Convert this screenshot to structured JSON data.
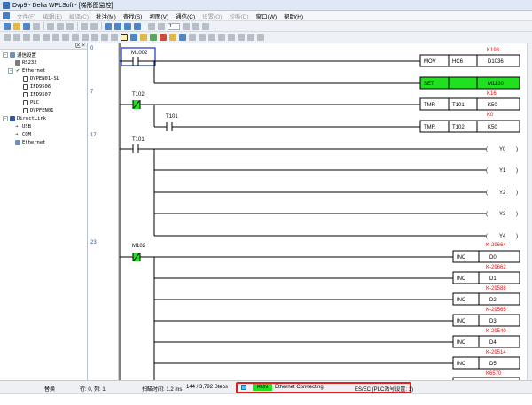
{
  "window": {
    "title": "Dvp9 - Delta WPLSoft - [梯形图监控]"
  },
  "menu": {
    "items": [
      {
        "label": "文件(F)",
        "disabled": true
      },
      {
        "label": "编辑(E)",
        "disabled": true
      },
      {
        "label": "编译(C)",
        "disabled": true
      },
      {
        "label": "批注(M)",
        "disabled": false
      },
      {
        "label": "查找(S)",
        "disabled": false
      },
      {
        "label": "视图(V)",
        "disabled": false
      },
      {
        "label": "通信(C)",
        "disabled": false
      },
      {
        "label": "设置(O)",
        "disabled": true
      },
      {
        "label": "诊断(D)",
        "disabled": true
      },
      {
        "label": "窗口(W)",
        "disabled": false
      },
      {
        "label": "帮助(H)",
        "disabled": false
      }
    ]
  },
  "toolbar": {
    "zoom_value": "1"
  },
  "tree": {
    "close_label": "区 ×",
    "items": [
      {
        "label": "通信设置",
        "level": 0,
        "icon": "network-icon",
        "expander": "-"
      },
      {
        "label": "RS232",
        "level": 1,
        "icon": "port-icon",
        "expander": ""
      },
      {
        "label": "Ethernet",
        "level": 1,
        "icon": "check-icon",
        "expander": "-"
      },
      {
        "label": "DVPEN01-SL",
        "level": 2,
        "icon": "document-icon",
        "expander": ""
      },
      {
        "label": "IFD9506",
        "level": 2,
        "icon": "document-icon",
        "expander": ""
      },
      {
        "label": "IFD9507",
        "level": 2,
        "icon": "document-icon",
        "expander": ""
      },
      {
        "label": "PLC",
        "level": 2,
        "icon": "document-icon",
        "expander": ""
      },
      {
        "label": "DVPFEN01",
        "level": 2,
        "icon": "document-icon",
        "expander": ""
      },
      {
        "label": "DirectLink",
        "level": 0,
        "icon": "directlink-icon",
        "expander": "-"
      },
      {
        "label": "USB",
        "level": 1,
        "icon": "arrow-icon",
        "expander": ""
      },
      {
        "label": "COM",
        "level": 1,
        "icon": "arrow-icon",
        "expander": ""
      },
      {
        "label": "Ethernet",
        "level": 1,
        "icon": "network-icon",
        "expander": ""
      }
    ]
  },
  "rung_numbers": [
    "0",
    "7",
    "17",
    "23"
  ],
  "ladder": {
    "contacts": {
      "m1002": "M1002",
      "t102": "T102",
      "t101_a": "T101",
      "t101_b": "T101",
      "m102": "M102"
    },
    "instructions": [
      {
        "op": "MOV",
        "arg1": "HC6",
        "arg2": "D1036",
        "value": "K198",
        "highlight": false
      },
      {
        "op": "SET",
        "arg1": "",
        "arg2": "M1130",
        "value": "",
        "highlight": true
      },
      {
        "op": "TMR",
        "arg1": "T101",
        "arg2": "K50",
        "value": "K16",
        "highlight": false
      },
      {
        "op": "TMR",
        "arg1": "T102",
        "arg2": "K50",
        "value": "K0",
        "highlight": false
      }
    ],
    "outputs": [
      "Y0",
      "Y1",
      "Y2",
      "Y3",
      "Y4"
    ],
    "incs": [
      {
        "op": "INC",
        "arg": "D0",
        "value": "K-29664"
      },
      {
        "op": "INC",
        "arg": "D1",
        "value": "K-29662"
      },
      {
        "op": "INC",
        "arg": "D2",
        "value": "K-29588"
      },
      {
        "op": "INC",
        "arg": "D3",
        "value": "K-29565"
      },
      {
        "op": "INC",
        "arg": "D4",
        "value": "K-29540"
      },
      {
        "op": "INC",
        "arg": "D5",
        "value": "K-29514"
      },
      {
        "op": "",
        "arg": "",
        "value": "K6570"
      }
    ]
  },
  "status": {
    "mode": "替换",
    "position": "行: 0, 列: 1",
    "scan_time": "扫瞄时间: 1.2 ms",
    "steps": "144 / 3,792 Steps",
    "run_label": "RUN",
    "connection": "Ethernet Connecting",
    "station": "ES/EC (PLC站号设置: 1)"
  },
  "colors": {
    "active_fill": "#20e020",
    "value_red": "#e01010",
    "highlight_border": "#1a2fd0",
    "status_box": "#e02020"
  }
}
